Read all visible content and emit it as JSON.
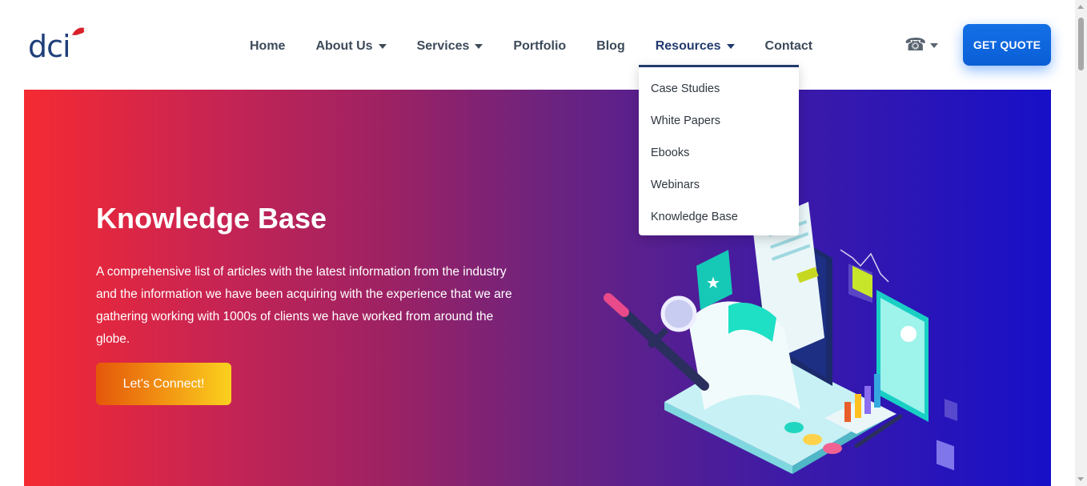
{
  "brand": {
    "logo_text": "dci"
  },
  "nav": {
    "items": [
      {
        "label": "Home",
        "has_caret": false
      },
      {
        "label": "About Us",
        "has_caret": true
      },
      {
        "label": "Services",
        "has_caret": true
      },
      {
        "label": "Portfolio",
        "has_caret": false
      },
      {
        "label": "Blog",
        "has_caret": false
      },
      {
        "label": "Resources",
        "has_caret": true,
        "active": true
      },
      {
        "label": "Contact",
        "has_caret": false
      }
    ],
    "phone_icon": "telephone-icon",
    "phone_glyph": "☎",
    "quote_label": "GET QUOTE"
  },
  "dropdown": {
    "items": [
      {
        "label": "Case Studies"
      },
      {
        "label": "White Papers"
      },
      {
        "label": "Ebooks"
      },
      {
        "label": "Webinars"
      },
      {
        "label": "Knowledge Base"
      }
    ]
  },
  "hero": {
    "title": "Knowledge Base",
    "description": "A comprehensive list of articles with the latest information from the industry and the information we have been acquiring with the experience that we are gathering working with 1000s of clients we have worked from around the globe.",
    "cta_label": "Let's Connect!",
    "colors": {
      "start": "#f52a32",
      "mid": "#9e2263",
      "end": "#1710c8"
    }
  },
  "colors": {
    "accent": "#0d6efd",
    "nav_text": "#3d4a5a",
    "nav_active": "#213a6e"
  }
}
